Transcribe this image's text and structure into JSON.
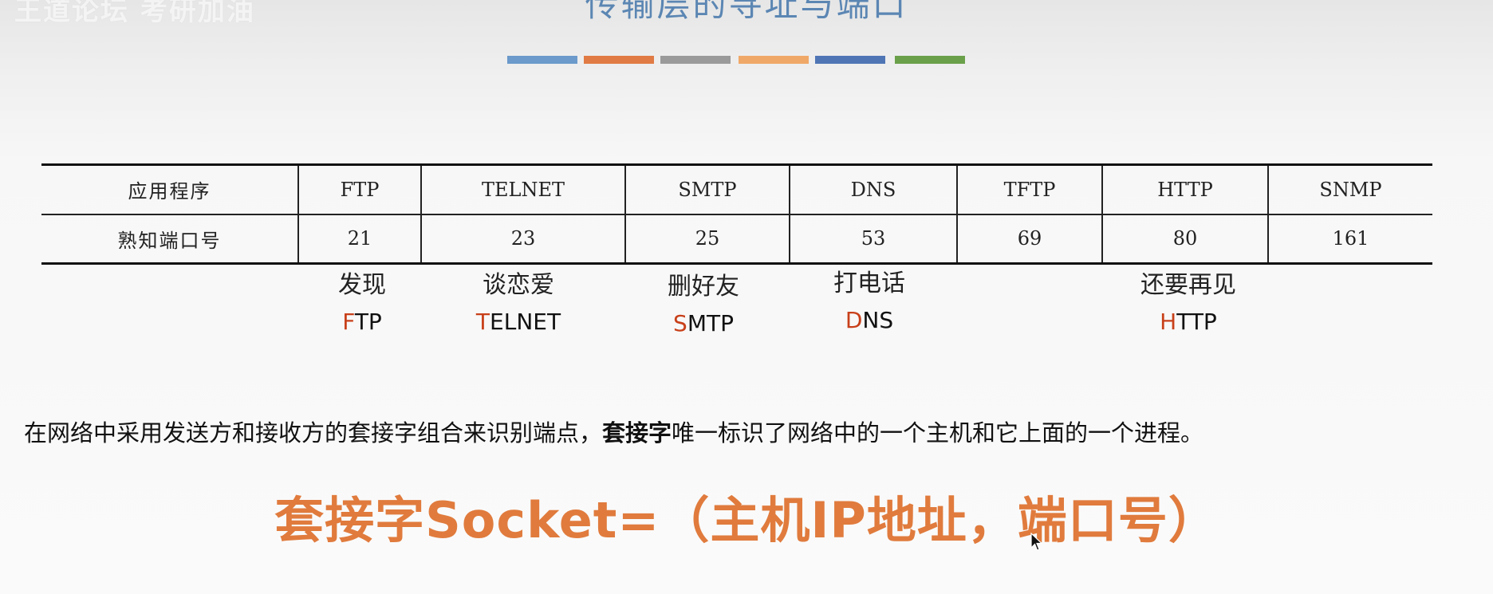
{
  "watermark": "王道论坛 考研加油",
  "title": "传输层的寻址与端口",
  "title_bars": [
    "#6b9acb",
    "#e07b45",
    "#9a9a9a",
    "#f0a868",
    "#4f75b5",
    "#6aa04a"
  ],
  "table": {
    "header_label": "应用程序",
    "port_label": "熟知端口号",
    "apps": [
      "FTP",
      "TELNET",
      "SMTP",
      "DNS",
      "TFTP",
      "HTTP",
      "SNMP"
    ],
    "ports": [
      "21",
      "23",
      "25",
      "53",
      "69",
      "80",
      "161"
    ]
  },
  "mnemonics": [
    {
      "cn": "发现",
      "first": "F",
      "rest": "TP"
    },
    {
      "cn": "谈恋爱",
      "first": "T",
      "rest": "ELNET"
    },
    {
      "cn": "删好友",
      "first": "S",
      "rest": "MTP"
    },
    {
      "cn": "打电话",
      "first": "D",
      "rest": "NS"
    },
    {
      "cn": "还要再见",
      "first": "H",
      "rest": "TTP"
    }
  ],
  "sentence": {
    "part1": "在网络中采用发送方和接收方的套接字组合来识别端点，",
    "bold": "套接字",
    "part2": "唯一标识了网络中的一个主机和它上面的一个进程。"
  },
  "formula": "套接字Socket=（主机IP地址，端口号）",
  "accent_color": "#e07b3d",
  "mnemonic_highlight_color": "#c8401a"
}
